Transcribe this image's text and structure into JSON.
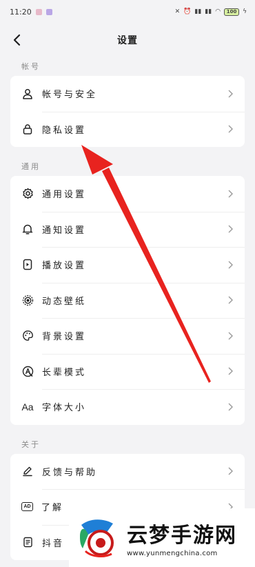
{
  "status_bar": {
    "time": "11:20",
    "battery": "100"
  },
  "nav": {
    "title": "设置"
  },
  "sections": [
    {
      "label": "帐号",
      "items": [
        {
          "label": "帐号与安全",
          "icon": "user-icon"
        },
        {
          "label": "隐私设置",
          "icon": "lock-icon"
        }
      ]
    },
    {
      "label": "通用",
      "items": [
        {
          "label": "通用设置",
          "icon": "gear-icon"
        },
        {
          "label": "通知设置",
          "icon": "bell-icon"
        },
        {
          "label": "播放设置",
          "icon": "play-settings-icon"
        },
        {
          "label": "动态壁纸",
          "icon": "live-wallpaper-icon"
        },
        {
          "label": "背景设置",
          "icon": "palette-icon"
        },
        {
          "label": "长辈模式",
          "icon": "elder-mode-icon"
        },
        {
          "label": "字体大小",
          "icon": "font-size-icon",
          "icon_text": "Aa"
        }
      ]
    },
    {
      "label": "关于",
      "items": [
        {
          "label": "反馈与帮助",
          "icon": "feedback-icon"
        },
        {
          "label": "了解",
          "icon": "ad-icon",
          "icon_text": "AD"
        },
        {
          "label": "抖音",
          "icon": "document-icon"
        }
      ]
    }
  ],
  "watermark": {
    "name": "云梦手游网",
    "url": "www.yunmengchina.com"
  },
  "colors": {
    "annotation_arrow": "#e8231f",
    "background": "#f3f3f5",
    "card": "#ffffff"
  }
}
